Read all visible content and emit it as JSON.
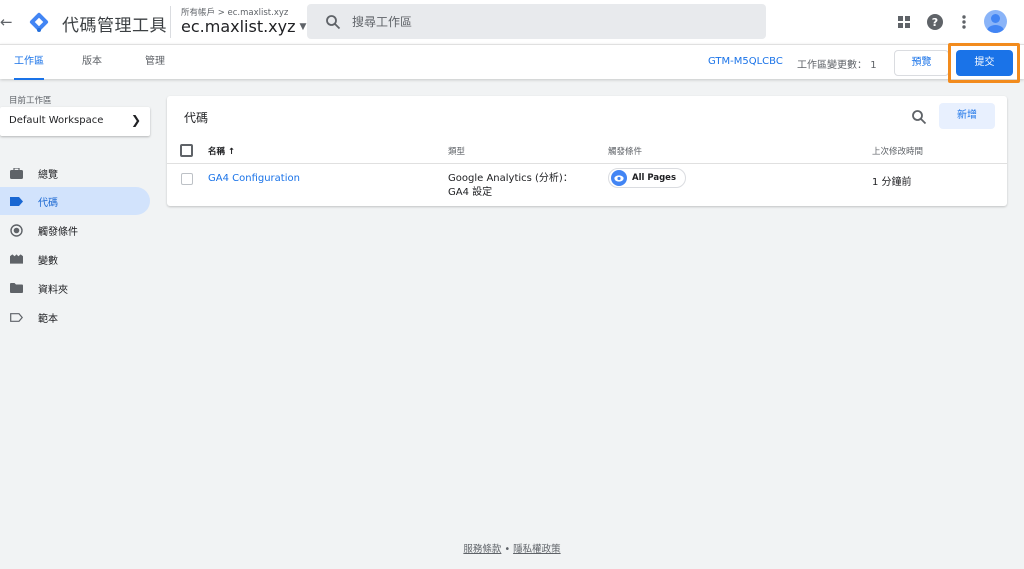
{
  "app": {
    "title": "代碼管理工具"
  },
  "account": {
    "breadcrumb": "所有帳戶 > ec.maxlist.xyz",
    "container_name": "ec.maxlist.xyz"
  },
  "search": {
    "placeholder": "搜尋工作區"
  },
  "header_icons": [
    "back-arrow-icon",
    "gtm-logo-icon",
    "apps-grid-icon",
    "help-icon",
    "more-vert-icon",
    "account-avatar-icon"
  ],
  "tabs": [
    {
      "label": "工作區",
      "active": true
    },
    {
      "label": "版本",
      "active": false
    },
    {
      "label": "管理",
      "active": false
    }
  ],
  "toolbar": {
    "container_id": "GTM-M5QLCBC",
    "changes_label": "工作區變更數：",
    "changes_count": "1",
    "preview_label": "預覽",
    "submit_label": "提交",
    "highlight_color": "#f28b1d"
  },
  "workspace": {
    "label": "目前工作區",
    "name": "Default Workspace"
  },
  "sidebar": {
    "items": [
      {
        "label": "總覽",
        "icon": "briefcase-icon",
        "active": false
      },
      {
        "label": "代碼",
        "icon": "tag-icon",
        "active": true
      },
      {
        "label": "觸發條件",
        "icon": "trigger-icon",
        "active": false
      },
      {
        "label": "變數",
        "icon": "variables-icon",
        "active": false
      },
      {
        "label": "資料夾",
        "icon": "folder-icon",
        "active": false
      },
      {
        "label": "範本",
        "icon": "template-label-icon",
        "active": false
      }
    ]
  },
  "tags_panel": {
    "title": "代碼",
    "new_label": "新增",
    "columns": {
      "name": "名稱",
      "sort_indicator": "↑",
      "type": "類型",
      "trigger": "觸發條件",
      "modified": "上次修改時間"
    },
    "rows": [
      {
        "name": "GA4 Configuration",
        "type": "Google Analytics (分析)：GA4 設定",
        "trigger": "All Pages",
        "modified": "1 分鐘前"
      }
    ]
  },
  "footer": {
    "terms": "服務條款",
    "separator": "•",
    "privacy": "隱私權政策"
  },
  "colors": {
    "accent": "#1a73e8",
    "active_nav_bg": "#d2e3fc",
    "page_bg": "#f1f3f4"
  }
}
